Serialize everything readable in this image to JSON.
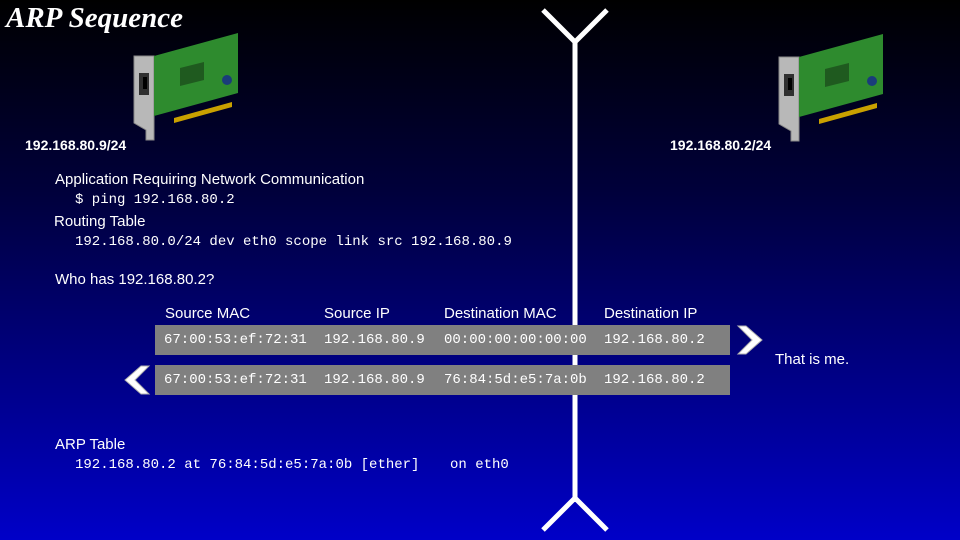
{
  "title": "ARP Sequence",
  "hosts": {
    "left": {
      "ip": "192.168.80.9/24",
      "icon": "network-card-icon"
    },
    "right": {
      "ip": "192.168.80.2/24",
      "icon": "network-card-icon"
    }
  },
  "left_text": {
    "app_heading": "Application Requiring Network Communication",
    "app_command": "$ ping 192.168.80.2",
    "routing_heading": "Routing Table",
    "routing_entry": "192.168.80.0/24 dev eth0 scope link src 192.168.80.9",
    "who_has": "Who has 192.168.80.2?"
  },
  "packet_table": {
    "headers": [
      "Source MAC",
      "Source IP",
      "Destination MAC",
      "Destination IP"
    ],
    "rows": [
      [
        "67:00:53:ef:72:31",
        "192.168.80.9",
        "00:00:00:00:00:00",
        "192.168.80.2"
      ],
      [
        "67:00:53:ef:72:31",
        "192.168.80.9",
        "76:84:5d:e5:7a:0b",
        "192.168.80.2"
      ]
    ]
  },
  "reply_note": "That is me.",
  "arp_table": {
    "heading": "ARP Table",
    "entry_main": "192.168.80.2 at 76:84:5d:e5:7a:0b [ether]",
    "entry_iface": "on eth0"
  },
  "colors": {
    "background_top": "#000000",
    "background_bottom": "#0000c8",
    "row_fill": "#808080",
    "card_green": "#2e8b2e",
    "bracket_gray": "#c0c0c0"
  }
}
